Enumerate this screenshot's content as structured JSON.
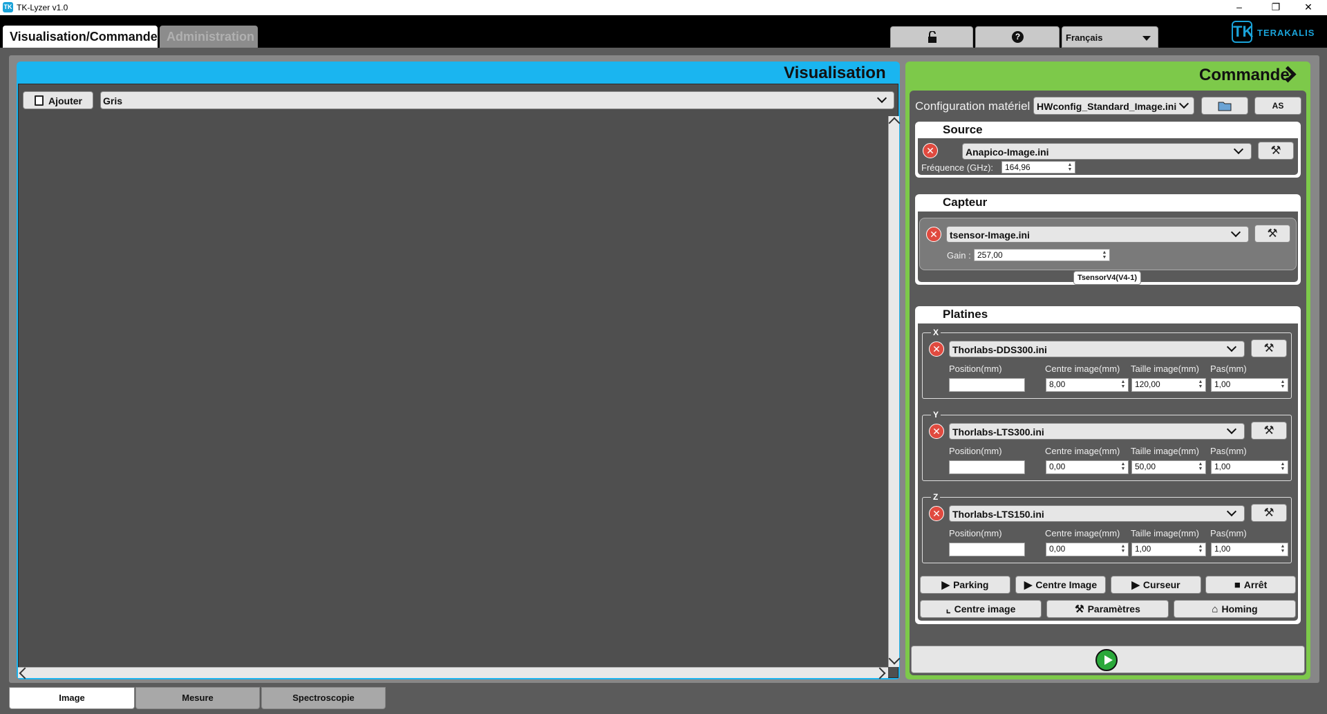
{
  "window": {
    "title": "TK-Lyzer v1.0",
    "app_icon": "TK"
  },
  "main_tabs": [
    {
      "label": "Visualisation/Commande",
      "active": true
    },
    {
      "label": "Administration",
      "active": false
    }
  ],
  "top_icons": {
    "lock": "lock-icon",
    "help": "?"
  },
  "language": {
    "selected": "Français"
  },
  "logo": {
    "mark": "TK",
    "text": "TERAKALIS"
  },
  "visualisation": {
    "title": "Visualisation",
    "add_button": "Ajouter",
    "palette": "Gris"
  },
  "commande": {
    "title": "Commande",
    "hw_label": "Configuration matériel :",
    "hw_value": "HWconfig_Standard_Image.ini",
    "as_button": "AS",
    "source": {
      "title": "Source",
      "file": "Anapico-Image.ini",
      "freq_label": "Fréquence (GHz):",
      "freq_value": "164,96"
    },
    "capteur": {
      "title": "Capteur",
      "file": "tsensor-Image.ini",
      "gain_label": "Gain :",
      "gain_value": "257,00",
      "badge": "TsensorV4(V4-1)"
    },
    "platines": {
      "title": "Platines",
      "col_position": "Position(mm)",
      "col_centre": "Centre image(mm)",
      "col_taille": "Taille image(mm)",
      "col_pas": "Pas(mm)",
      "axes": [
        {
          "letter": "X",
          "file": "Thorlabs-DDS300.ini",
          "position": "",
          "centre": "8,00",
          "taille": "120,00",
          "pas": "1,00"
        },
        {
          "letter": "Y",
          "file": "Thorlabs-LTS300.ini",
          "position": "",
          "centre": "0,00",
          "taille": "50,00",
          "pas": "1,00"
        },
        {
          "letter": "Z",
          "file": "Thorlabs-LTS150.ini",
          "position": "",
          "centre": "0,00",
          "taille": "1,00",
          "pas": "1,00"
        }
      ]
    },
    "actions_row1": [
      "Parking",
      "Centre Image",
      "Curseur",
      "Arrêt"
    ],
    "actions_row2": [
      "Centre image",
      "Paramètres",
      "Homing"
    ]
  },
  "bottom_tabs": [
    {
      "label": "Image",
      "active": true
    },
    {
      "label": "Mesure",
      "active": false
    },
    {
      "label": "Spectroscopie",
      "active": false
    }
  ],
  "colors": {
    "vis_header": "#1ab5f0",
    "cmd_header": "#7dc94a",
    "delete": "#e04a3f",
    "play": "#2aa83a"
  }
}
